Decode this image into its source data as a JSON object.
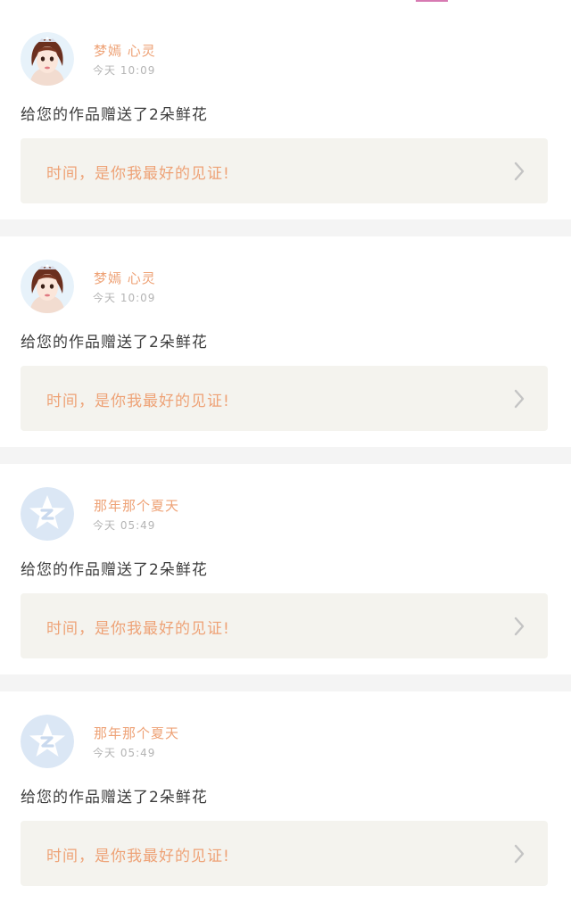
{
  "colors": {
    "username": "#eea276",
    "timestamp": "#b4b4b4",
    "message": "#3d3d3d",
    "gift_box_bg": "#f4f3ee",
    "gift_text": "#eea276",
    "divider": "#f4f4f4",
    "top_accent": "#d77ab2"
  },
  "feed": {
    "items": [
      {
        "avatar_icon": "girl-portrait-avatar",
        "username": "梦嫣 心灵",
        "time": "今天 10:09",
        "message": "给您的作品赠送了2朵鲜花",
        "gift_text": "时间，是你我最好的见证!",
        "chevron_icon": "chevron-right-icon"
      },
      {
        "avatar_icon": "girl-portrait-avatar",
        "username": "梦嫣 心灵",
        "time": "今天 10:09",
        "message": "给您的作品赠送了2朵鲜花",
        "gift_text": "时间，是你我最好的见证!",
        "chevron_icon": "chevron-right-icon"
      },
      {
        "avatar_icon": "qzone-star-avatar",
        "username": "那年那个夏天",
        "time": "今天 05:49",
        "message": "给您的作品赠送了2朵鲜花",
        "gift_text": "时间，是你我最好的见证!",
        "chevron_icon": "chevron-right-icon"
      },
      {
        "avatar_icon": "qzone-star-avatar",
        "username": "那年那个夏天",
        "time": "今天 05:49",
        "message": "给您的作品赠送了2朵鲜花",
        "gift_text": "时间，是你我最好的见证!",
        "chevron_icon": "chevron-right-icon"
      }
    ]
  }
}
